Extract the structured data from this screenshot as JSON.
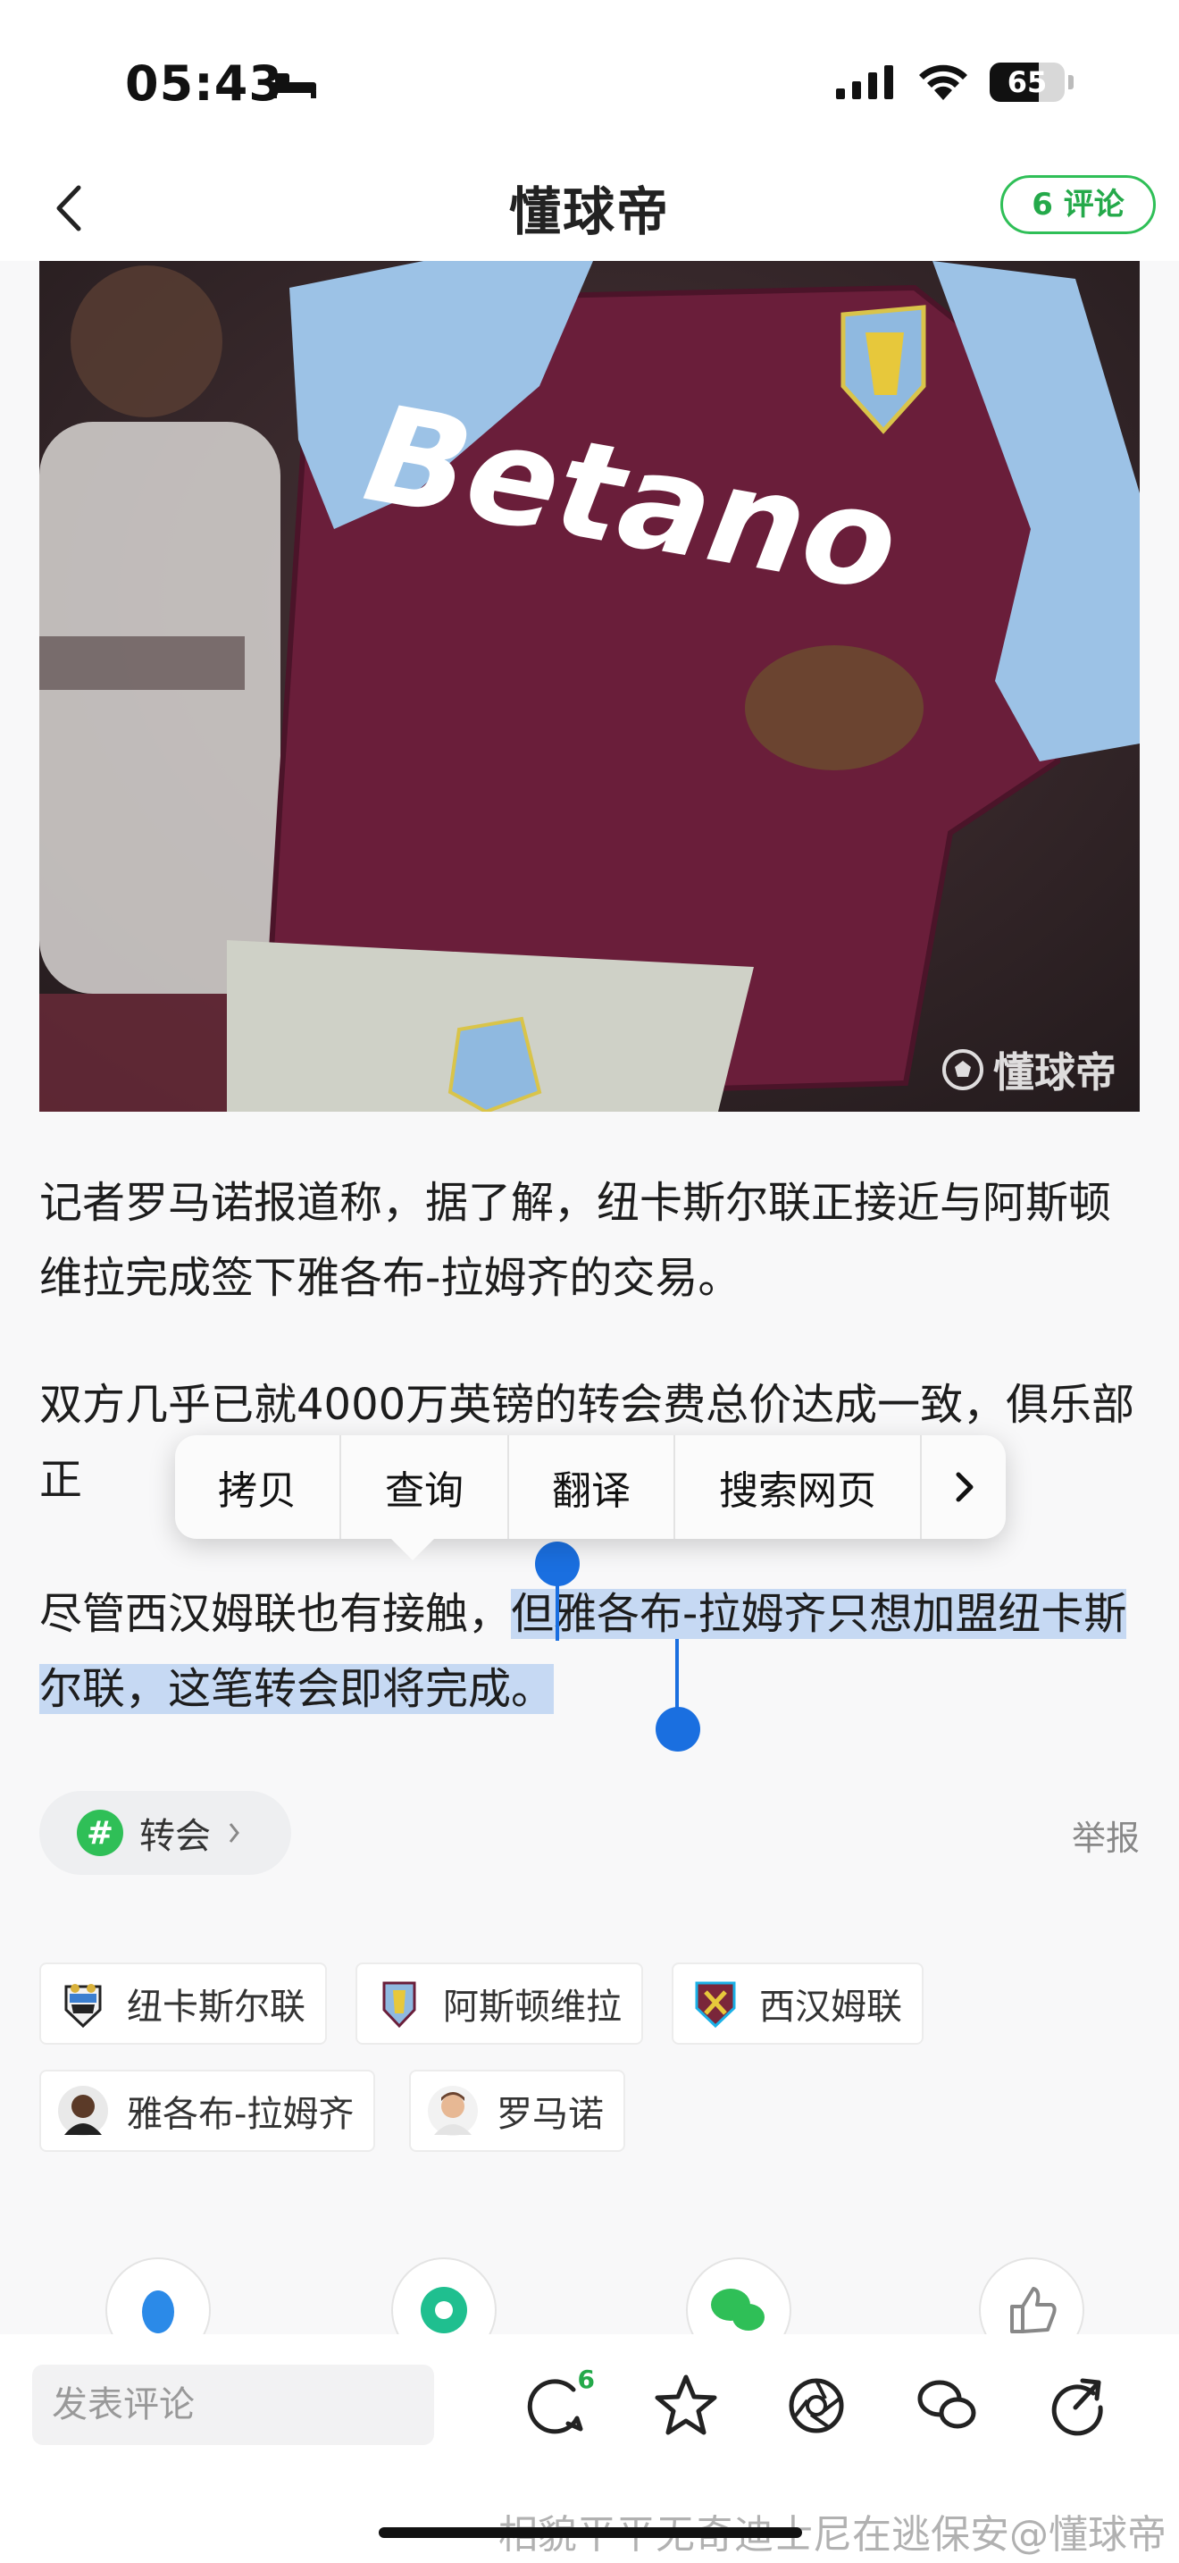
{
  "status_bar": {
    "time": "05:43",
    "battery": "65",
    "battery_level": 0.65
  },
  "nav": {
    "title": "懂球帝",
    "comment_label": "6 评论"
  },
  "photo": {
    "watermark": "懂球帝",
    "jersey_text": "Betano"
  },
  "article": {
    "para1": "记者罗马诺报道称，据了解，纽卡斯尔联正接近与阿斯顿维拉完成签下雅各布-拉姆齐的交易。",
    "para2": "双方几乎已就4000万英镑的转会费总价达成一致，俱乐部正",
    "para3_before": "尽管西汉姆联也有接触，",
    "para3_selected": "但雅各布-拉姆齐只想加盟纽卡斯尔联，这笔转会即将完成。"
  },
  "context_menu": {
    "items": [
      "拷贝",
      "查询",
      "翻译",
      "搜索网页"
    ]
  },
  "tag": {
    "label": "转会"
  },
  "report_label": "举报",
  "entities": [
    {
      "label": "纽卡斯尔联",
      "icon": "newcastle-crest-icon"
    },
    {
      "label": "阿斯顿维拉",
      "icon": "aston-villa-crest-icon"
    },
    {
      "label": "西汉姆联",
      "icon": "west-ham-crest-icon"
    },
    {
      "label": "雅各布-拉姆齐",
      "icon": "player-avatar-icon"
    },
    {
      "label": "罗马诺",
      "icon": "journalist-avatar-icon"
    }
  ],
  "bottom_bar": {
    "comment_placeholder": "发表评论",
    "comment_badge": "6"
  },
  "overlay_caption": "相貌平平无奇迪士尼在逃保安@懂球帝",
  "colors": {
    "accent": "#2fbf57",
    "selection": "#c6d9f3",
    "handle": "#1a6fe0"
  }
}
